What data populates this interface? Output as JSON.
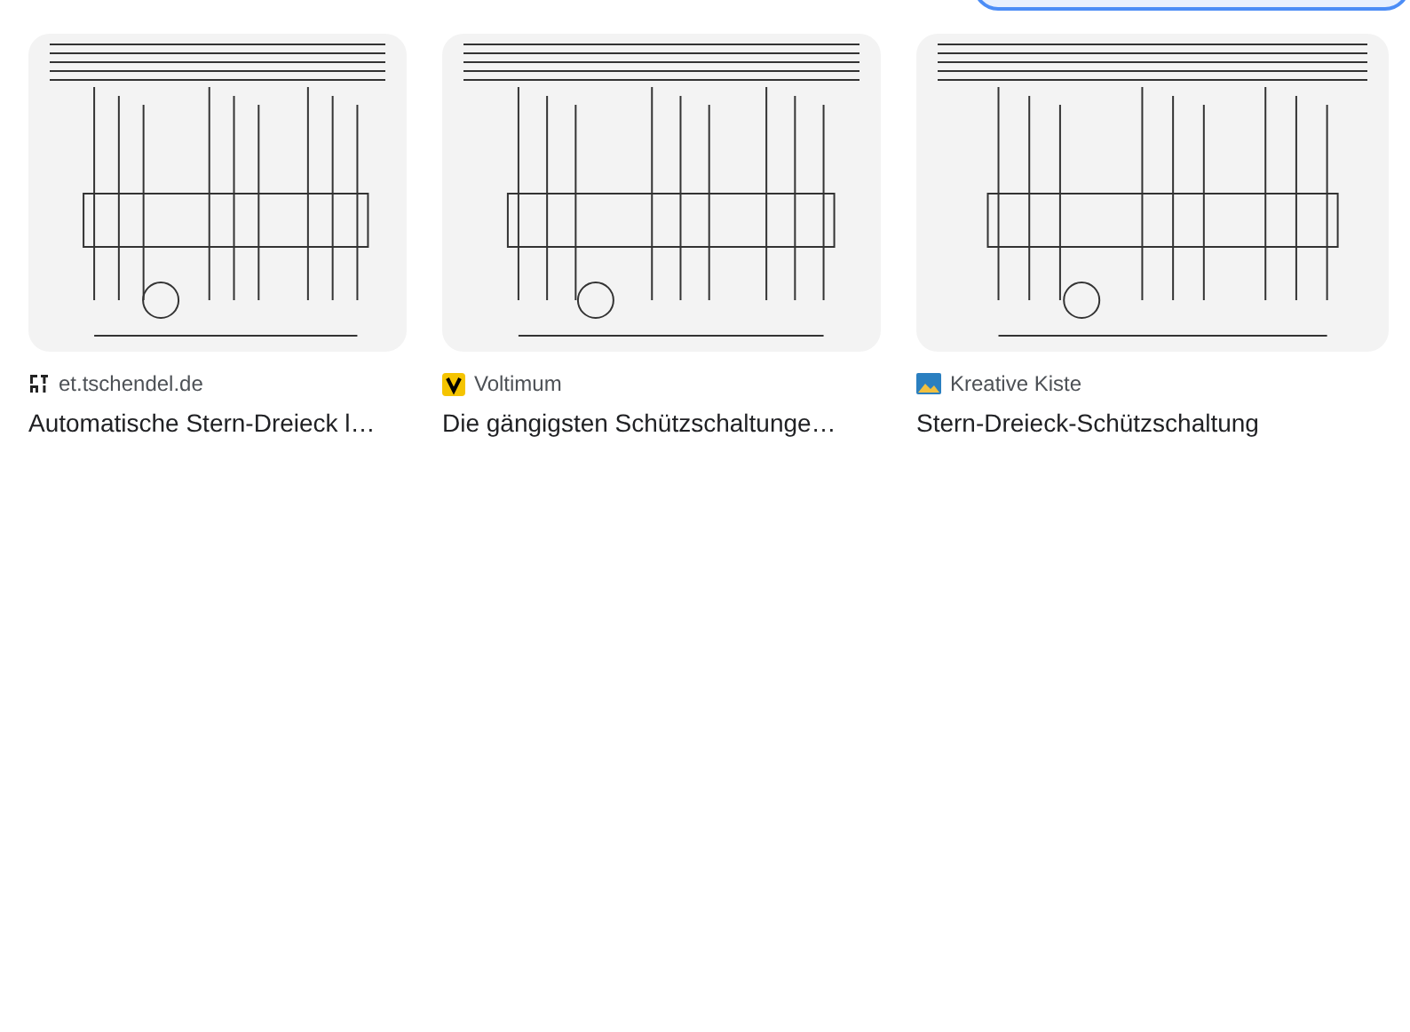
{
  "results": [
    {
      "source": "et.tschendel.de",
      "kind": "et",
      "title": "Automatische Stern-Dreieck l…"
    },
    {
      "source": "Voltimum",
      "kind": "voltimum",
      "title": "Die gängigsten Schützschaltunge…"
    },
    {
      "source": "Kreative Kiste",
      "kind": "kiste",
      "title": "Stern-Dreieck-Schützschaltung"
    }
  ]
}
